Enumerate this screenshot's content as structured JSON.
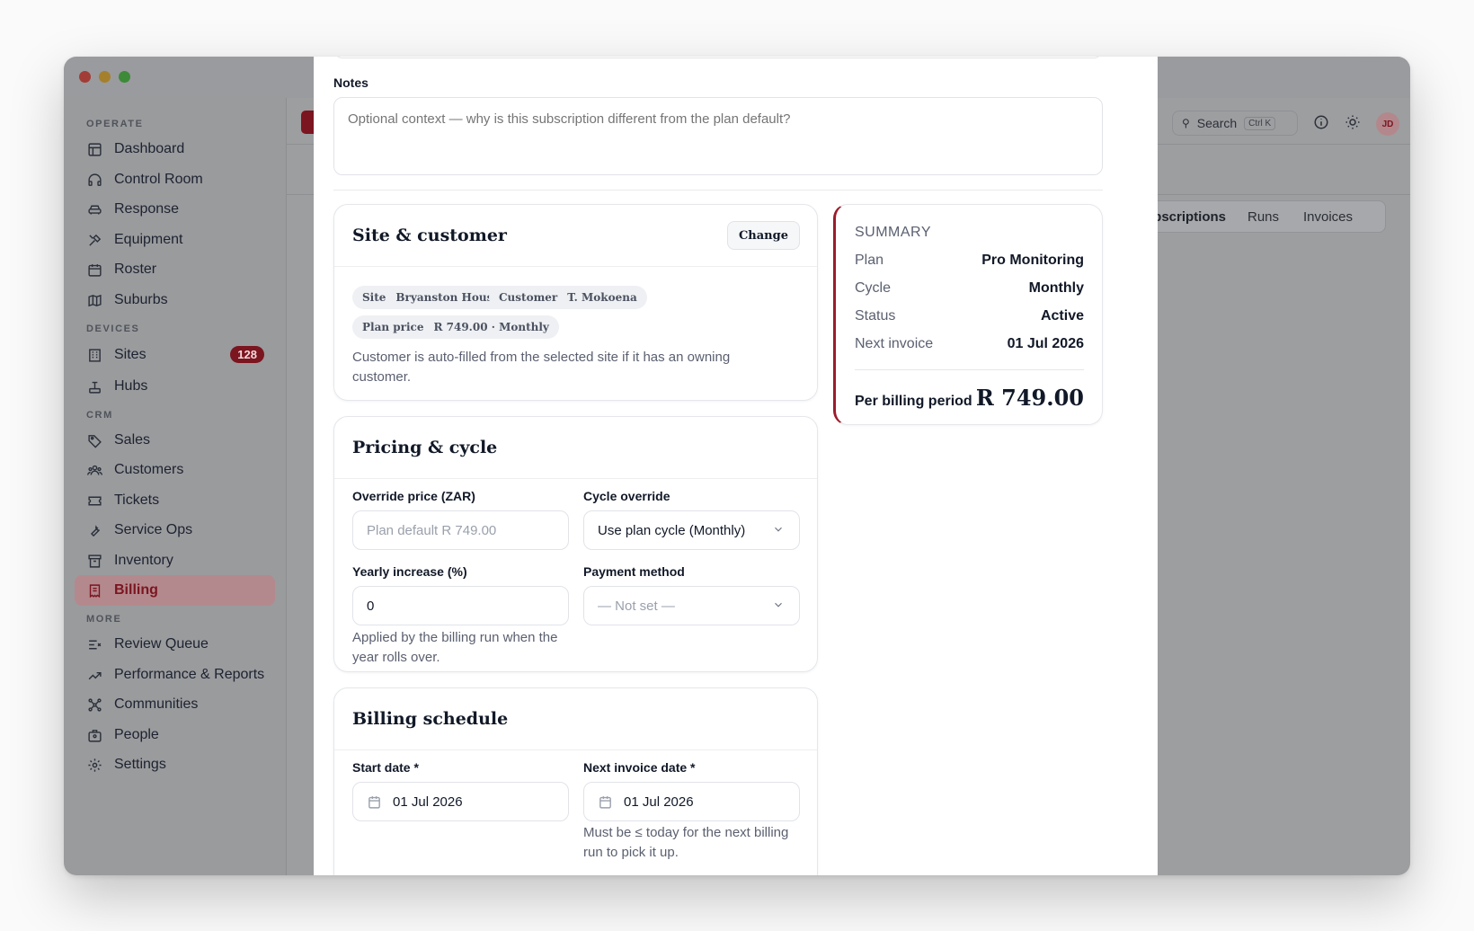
{
  "colors": {
    "accent": "#9b1c2b",
    "muted": "#5b6070"
  },
  "sidebar": {
    "sections": [
      {
        "title": "OPERATE",
        "items": [
          {
            "label": "Dashboard",
            "icon": "dashboard-icon"
          },
          {
            "label": "Control Room",
            "icon": "headset-icon"
          },
          {
            "label": "Response",
            "icon": "car-icon"
          },
          {
            "label": "Equipment",
            "icon": "tools-icon"
          },
          {
            "label": "Roster",
            "icon": "calendar-icon"
          },
          {
            "label": "Suburbs",
            "icon": "map-icon"
          }
        ]
      },
      {
        "title": "DEVICES",
        "items": [
          {
            "label": "Sites",
            "icon": "building-icon",
            "badge": "128"
          },
          {
            "label": "Hubs",
            "icon": "hub-icon"
          }
        ]
      },
      {
        "title": "CRM",
        "items": [
          {
            "label": "Sales",
            "icon": "tag-icon"
          },
          {
            "label": "Customers",
            "icon": "users-icon"
          },
          {
            "label": "Tickets",
            "icon": "ticket-icon"
          },
          {
            "label": "Service Ops",
            "icon": "wrench-icon"
          },
          {
            "label": "Inventory",
            "icon": "archive-icon"
          },
          {
            "label": "Billing",
            "icon": "receipt-icon",
            "active": true
          }
        ]
      },
      {
        "title": "MORE",
        "items": [
          {
            "label": "Review Queue",
            "icon": "queue-icon"
          },
          {
            "label": "Performance & Reports",
            "icon": "trend-icon"
          },
          {
            "label": "Communities",
            "icon": "network-icon"
          },
          {
            "label": "People",
            "icon": "people-icon"
          },
          {
            "label": "Settings",
            "icon": "gear-icon"
          }
        ]
      }
    ]
  },
  "header": {
    "search_label": "Search",
    "search_shortcut": "Ctrl K",
    "avatar_initials": "JD"
  },
  "bg_tabs": [
    "ubscriptions",
    "Runs",
    "Invoices"
  ],
  "form": {
    "notes": {
      "label": "Notes",
      "placeholder": "Optional context — why is this subscription different from the plan default?"
    },
    "site_customer": {
      "title": "Site & customer",
      "change_label": "Change",
      "chips": [
        {
          "k": "Site",
          "v": "Bryanston House"
        },
        {
          "k": "Customer",
          "v": "T. Mokoena"
        },
        {
          "k": "Plan price",
          "v": "R 749.00 · Monthly"
        }
      ],
      "help": "Customer is auto-filled from the selected site if it has an owning customer."
    },
    "pricing": {
      "title": "Pricing & cycle",
      "override_price": {
        "label": "Override price (ZAR)",
        "placeholder": "Plan default R 749.00"
      },
      "cycle_override": {
        "label": "Cycle override",
        "value": "Use plan cycle (Monthly)"
      },
      "yearly_increase": {
        "label": "Yearly increase (%)",
        "value": "0",
        "help": "Applied by the billing run when the year rolls over."
      },
      "payment_method": {
        "label": "Payment method",
        "value": "— Not set —"
      }
    },
    "schedule": {
      "title": "Billing schedule",
      "start_date": {
        "label": "Start date *",
        "value": "01 Jul 2026"
      },
      "next_invoice": {
        "label": "Next invoice date *",
        "value": "01 Jul 2026",
        "help": "Must be ≤ today for the next billing run to pick it up."
      }
    }
  },
  "summary": {
    "title": "SUMMARY",
    "rows": [
      {
        "k": "Plan",
        "v": "Pro Monitoring"
      },
      {
        "k": "Cycle",
        "v": "Monthly"
      },
      {
        "k": "Status",
        "v": "Active"
      },
      {
        "k": "Next invoice",
        "v": "01 Jul 2026"
      }
    ],
    "total_label": "Per billing period",
    "total_value": "R 749.00"
  }
}
